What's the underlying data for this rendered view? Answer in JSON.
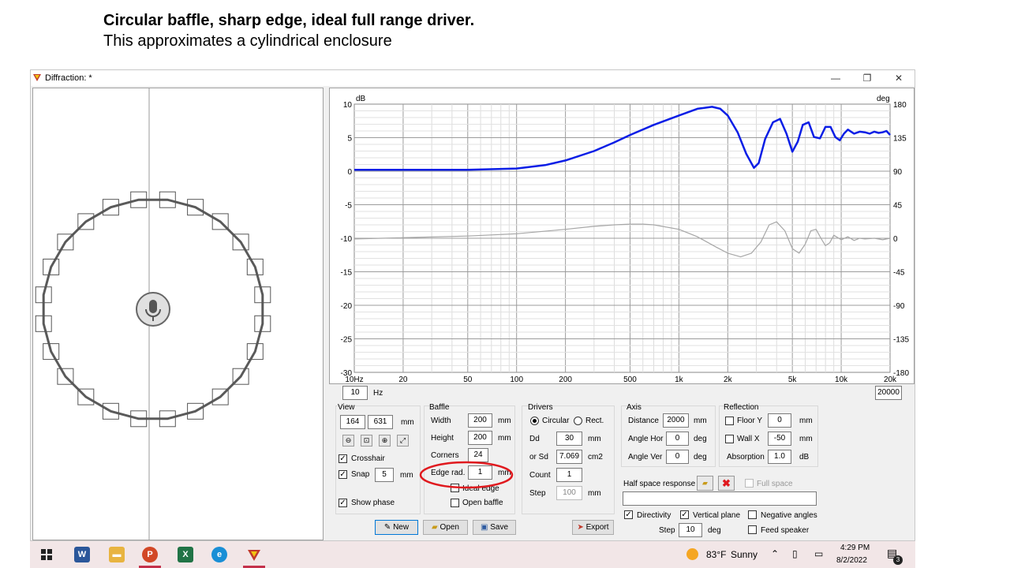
{
  "slide": {
    "title": "Circular baffle, sharp edge, ideal full range driver.",
    "subtitle": "This approximates a cylindrical enclosure"
  },
  "window": {
    "title": "Diffraction: *",
    "minimize": "—",
    "restore": "❐",
    "close": "✕"
  },
  "chart_data": {
    "type": "line",
    "xscale": "log",
    "xlim": [
      10,
      20000
    ],
    "ylim_left": [
      -30,
      10
    ],
    "ylim_right": [
      -180,
      180
    ],
    "ylabel_left": "dB",
    "ylabel_right": "deg",
    "grid": true,
    "x_tick_labels": [
      "10Hz",
      "20",
      "50",
      "100",
      "200",
      "500",
      "1k",
      "2k",
      "5k",
      "10k",
      "20k"
    ],
    "x_tick_values": [
      10,
      20,
      50,
      100,
      200,
      500,
      1000,
      2000,
      5000,
      10000,
      20000
    ],
    "y_left_ticks": [
      "10",
      "5",
      "0",
      "-5",
      "-10",
      "-15",
      "-20",
      "-25",
      "-30"
    ],
    "y_left_tick_values": [
      10,
      5,
      0,
      -5,
      -10,
      -15,
      -20,
      -25,
      -30
    ],
    "y_right_ticks": [
      "180",
      "135",
      "90",
      "45",
      "0",
      "-45",
      "-90",
      "-135",
      "-180"
    ],
    "y_right_tick_values": [
      180,
      135,
      90,
      45,
      0,
      -45,
      -90,
      -135,
      -180
    ],
    "series": [
      {
        "role": "magnitude",
        "axis": "left",
        "color": "#0a1ee6",
        "x": [
          10,
          50,
          100,
          150,
          200,
          300,
          400,
          500,
          700,
          1000,
          1300,
          1600,
          1800,
          2000,
          2300,
          2600,
          2900,
          3100,
          3400,
          3800,
          4200,
          4600,
          5000,
          5400,
          5800,
          6300,
          6800,
          7400,
          8000,
          8600,
          9200,
          9800,
          10400,
          11000,
          12000,
          13000,
          14000,
          15000,
          16000,
          17000,
          18000,
          19000,
          20000
        ],
        "y": [
          0.2,
          0.2,
          0.4,
          0.9,
          1.6,
          3.0,
          4.3,
          5.4,
          6.9,
          8.3,
          9.3,
          9.6,
          9.3,
          8.3,
          5.8,
          2.6,
          0.5,
          1.2,
          4.8,
          7.3,
          7.8,
          5.6,
          2.9,
          4.4,
          6.9,
          7.3,
          5.1,
          4.9,
          6.6,
          6.6,
          5.1,
          4.6,
          5.6,
          6.2,
          5.6,
          5.9,
          5.8,
          5.6,
          5.9,
          5.7,
          5.8,
          6.0,
          5.4
        ]
      },
      {
        "role": "phase",
        "axis": "right",
        "color": "#a6a6a6",
        "x": [
          10,
          50,
          100,
          200,
          300,
          400,
          500,
          600,
          700,
          1000,
          1300,
          1700,
          2000,
          2400,
          2800,
          3200,
          3600,
          4000,
          4500,
          5000,
          5500,
          6000,
          6500,
          7000,
          7500,
          8000,
          8500,
          9000,
          10000,
          11000,
          12000,
          13000,
          14000,
          16000,
          18000,
          20000
        ],
        "y": [
          -1,
          3,
          6,
          12,
          16,
          18,
          19,
          19,
          18,
          12,
          2,
          -12,
          -20,
          -25,
          -20,
          -5,
          18,
          22,
          10,
          -14,
          -20,
          -8,
          10,
          12,
          0,
          -10,
          -6,
          4,
          -2,
          2,
          -3,
          0,
          -1,
          0,
          -2,
          0
        ]
      }
    ]
  },
  "controls": {
    "freq_min": "10",
    "freq_unit": "Hz",
    "freq_max": "20000",
    "view": {
      "label": "View",
      "x": "164",
      "y": "631",
      "unit": "mm",
      "crosshair_label": "Crosshair",
      "crosshair": true,
      "snap_label": "Snap",
      "snap": true,
      "snap_value": "5",
      "snap_unit": "mm",
      "show_phase_label": "Show phase",
      "show_phase": true
    },
    "baffle": {
      "label": "Baffle",
      "width_label": "Width",
      "width": "200",
      "height_label": "Height",
      "height": "200",
      "unit": "mm",
      "corners_label": "Corners",
      "corners": "24",
      "edge_rad_label": "Edge rad.",
      "edge_rad": "1",
      "edge_unit": "mm",
      "ideal_edge_label": "Ideal edge",
      "open_baffle_label": "Open baffle"
    },
    "drivers": {
      "label": "Drivers",
      "circular_label": "Circular",
      "rect_label": "Rect.",
      "dd_label": "Dd",
      "dd": "30",
      "dd_unit": "mm",
      "sd_label": "or Sd",
      "sd": "7.069",
      "sd_unit": "cm2",
      "count_label": "Count",
      "count": "1",
      "step_label": "Step",
      "step": "100",
      "step_unit": "mm"
    },
    "axis": {
      "label": "Axis",
      "distance_label": "Distance",
      "distance": "2000",
      "distance_unit": "mm",
      "angle_hor_label": "Angle Hor",
      "angle_hor": "0",
      "angle_ver_label": "Angle Ver",
      "angle_ver": "0",
      "deg": "deg"
    },
    "reflection": {
      "label": "Reflection",
      "floor_label": "Floor Y",
      "floor": "0",
      "wall_label": "Wall  X",
      "wall": "-50",
      "unit": "mm",
      "absorption_label": "Absorption",
      "absorption": "1.0",
      "absorption_unit": "dB"
    },
    "half_space_label": "Half space response",
    "full_space_label": "Full space",
    "directivity_label": "Directivity",
    "vertical_plane_label": "Vertical plane",
    "negative_angles_label": "Negative angles",
    "feed_speaker_label": "Feed speaker",
    "dir_step_label": "Step",
    "dir_step": "10",
    "dir_step_unit": "deg",
    "new_label": "New",
    "open_label": "Open",
    "save_label": "Save",
    "export_label": "Export"
  },
  "taskbar": {
    "weather_temp": "83°F",
    "weather_text": "Sunny",
    "time": "4:29 PM",
    "date": "8/2/2022",
    "notification_count": "3"
  }
}
